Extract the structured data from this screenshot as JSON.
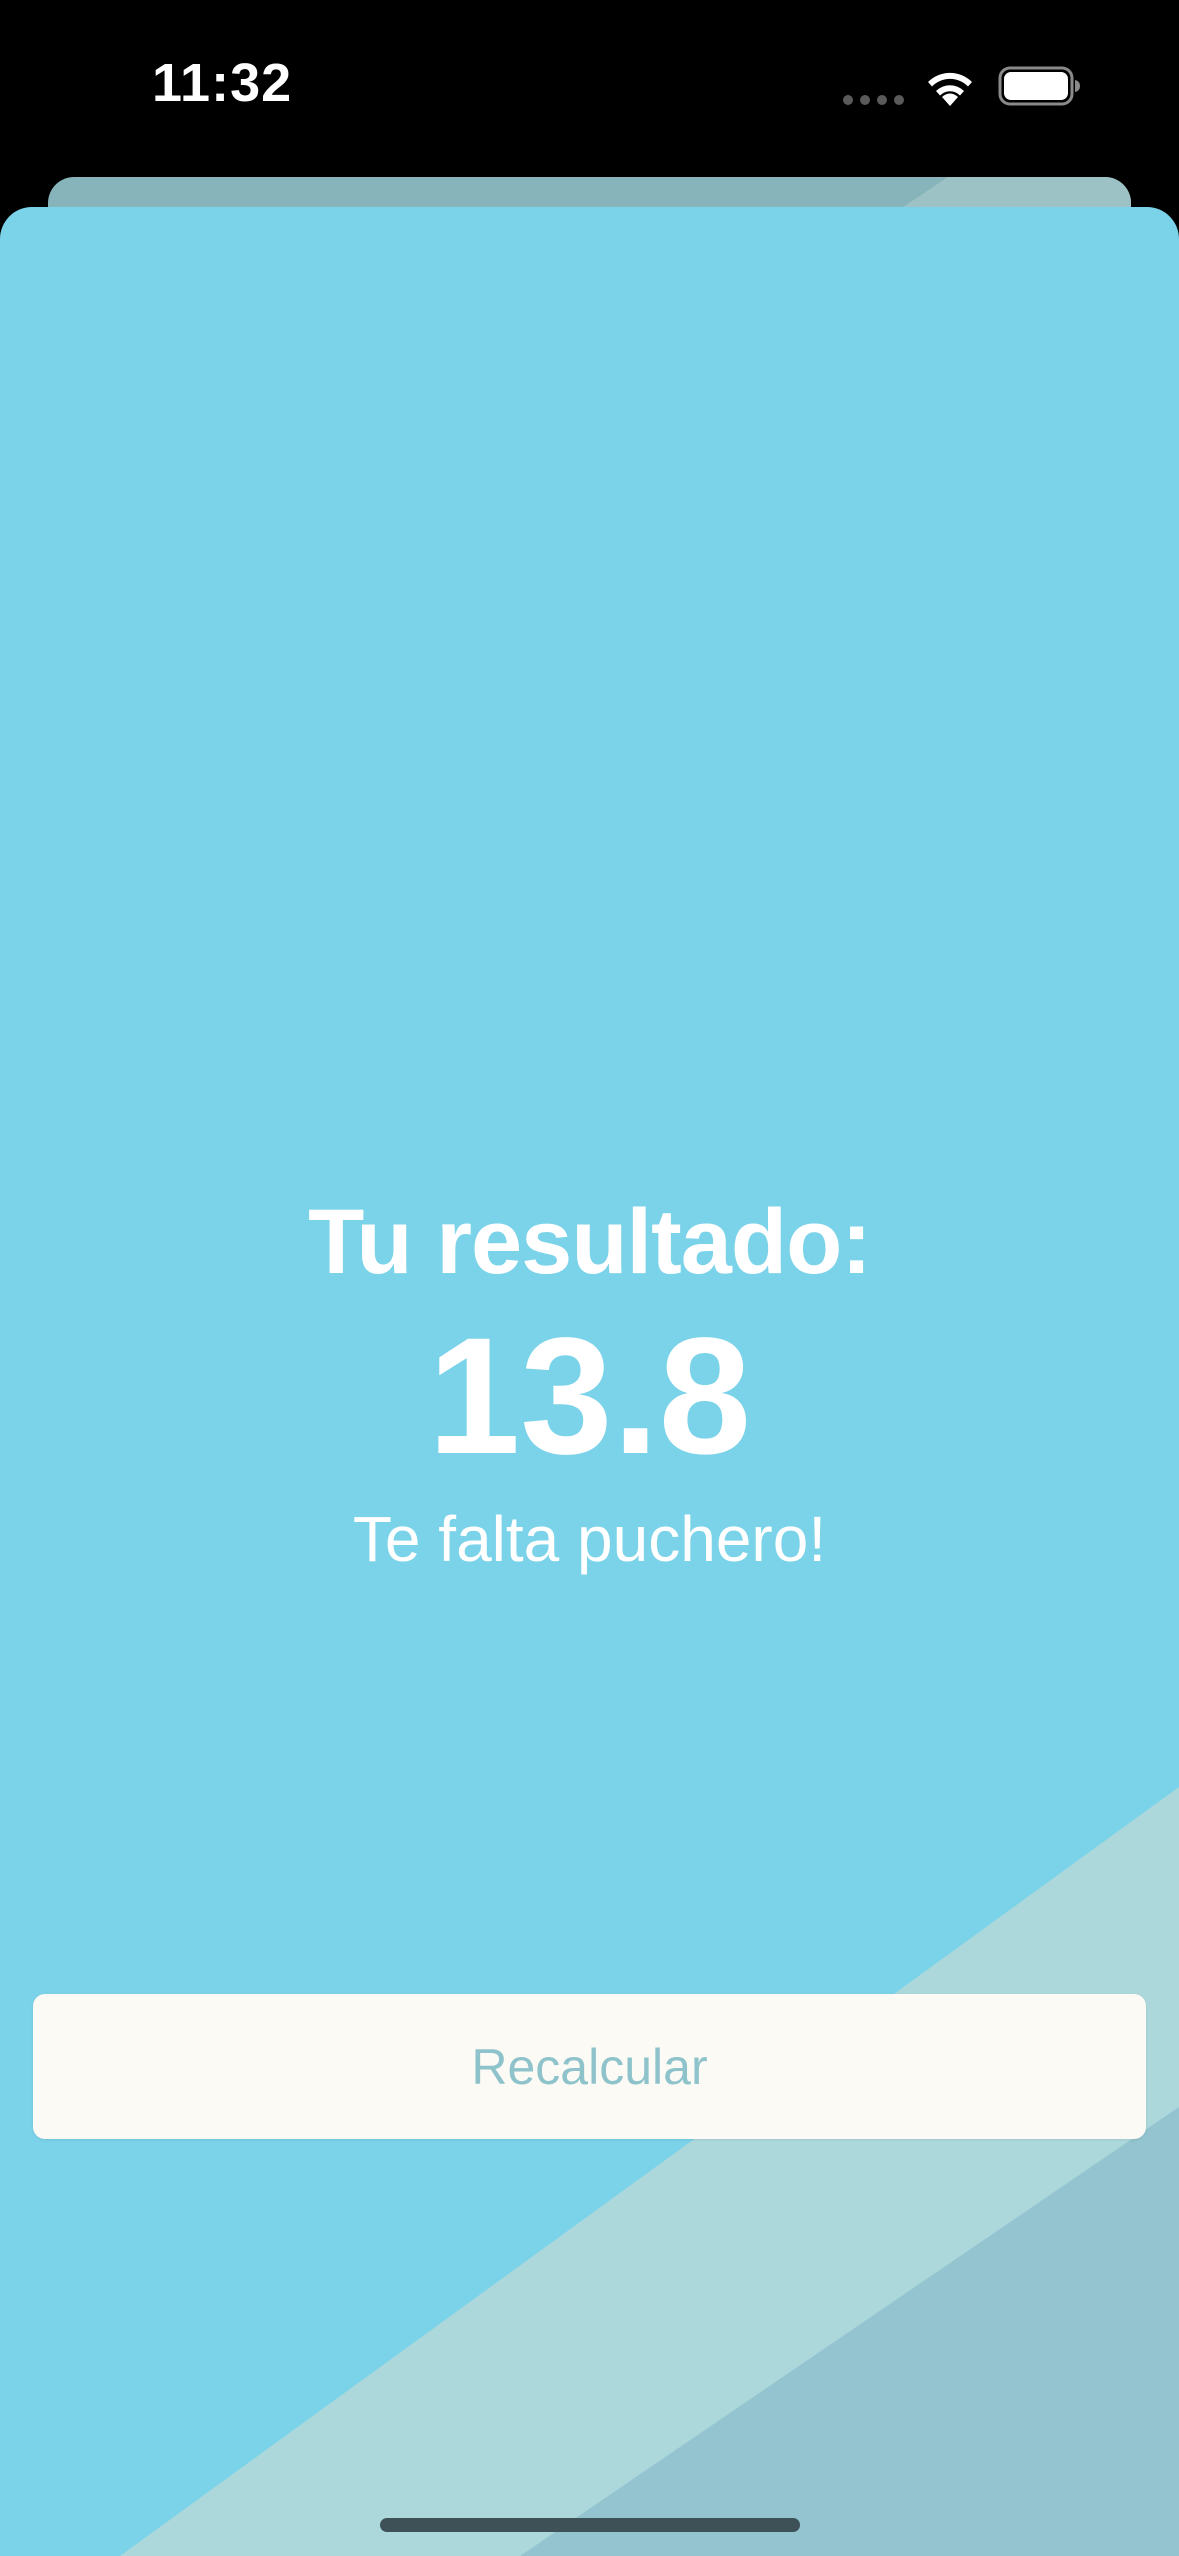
{
  "status_bar": {
    "time": "11:32",
    "wifi_icon": "wifi-icon",
    "battery_icon": "battery-icon",
    "signal_icon": "cellular-dots-icon"
  },
  "result": {
    "title": "Tu resultado:",
    "value": "13.8",
    "message": "Te falta puchero!"
  },
  "actions": {
    "recalculate_label": "Recalcular"
  },
  "colors": {
    "background_blue": "#7bd3e9",
    "accent_light": "#acd8dc",
    "accent_dark": "#93c4d0",
    "button_bg": "#fcfaf4",
    "button_text": "#8ec3cc",
    "result_text": "#ffffff"
  }
}
